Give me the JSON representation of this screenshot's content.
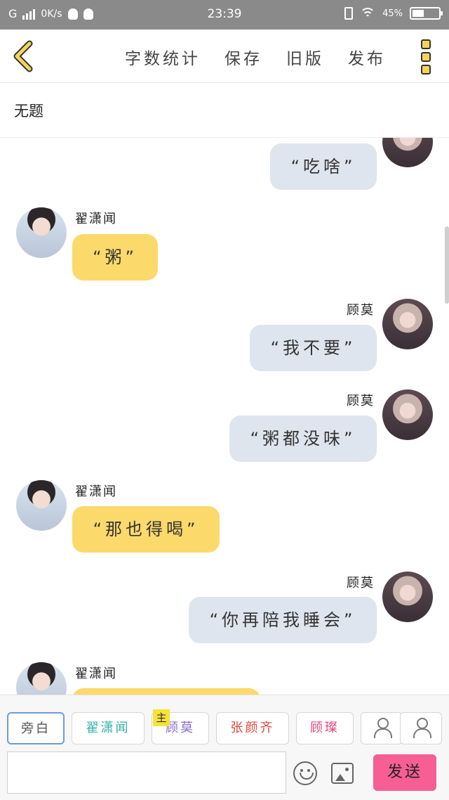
{
  "status_bar": {
    "network": "G",
    "speed": "0K/s",
    "time": "23:39",
    "battery": "45%",
    "battery_level": 0.45
  },
  "header": {
    "actions": [
      "字数统计",
      "保存",
      "旧版",
      "发布"
    ]
  },
  "title": "无题",
  "colors": {
    "accent_yellow": "#fbd96b",
    "bubble_gray": "#dfe5ee",
    "send_pink": "#f65e94"
  },
  "chat": {
    "messages": [
      {
        "side": "right",
        "name": "",
        "text": "“吃啥”"
      },
      {
        "side": "left",
        "name": "翟潇闻",
        "text": "“粥”"
      },
      {
        "side": "right",
        "name": "顾莫",
        "text": "“我不要”"
      },
      {
        "side": "right",
        "name": "顾莫",
        "text": "“粥都没味”"
      },
      {
        "side": "left",
        "name": "翟潇闻",
        "text": "“那也得喝”"
      },
      {
        "side": "right",
        "name": "顾莫",
        "text": "“你再陪我睡会”"
      },
      {
        "side": "left",
        "name": "翟潇闻",
        "text": ""
      }
    ]
  },
  "composer": {
    "roles": [
      {
        "label": "旁白",
        "color": "#555555"
      },
      {
        "label": "翟潇闻",
        "color": "#2fb3a6"
      },
      {
        "label": "顾莫",
        "color": "#8a6ad0"
      },
      {
        "label": "张颜齐",
        "color": "#e0483c"
      },
      {
        "label": "顾璨",
        "color": "#e0467d"
      }
    ],
    "host_tag": "主",
    "input_value": "",
    "send_label": "发送"
  }
}
